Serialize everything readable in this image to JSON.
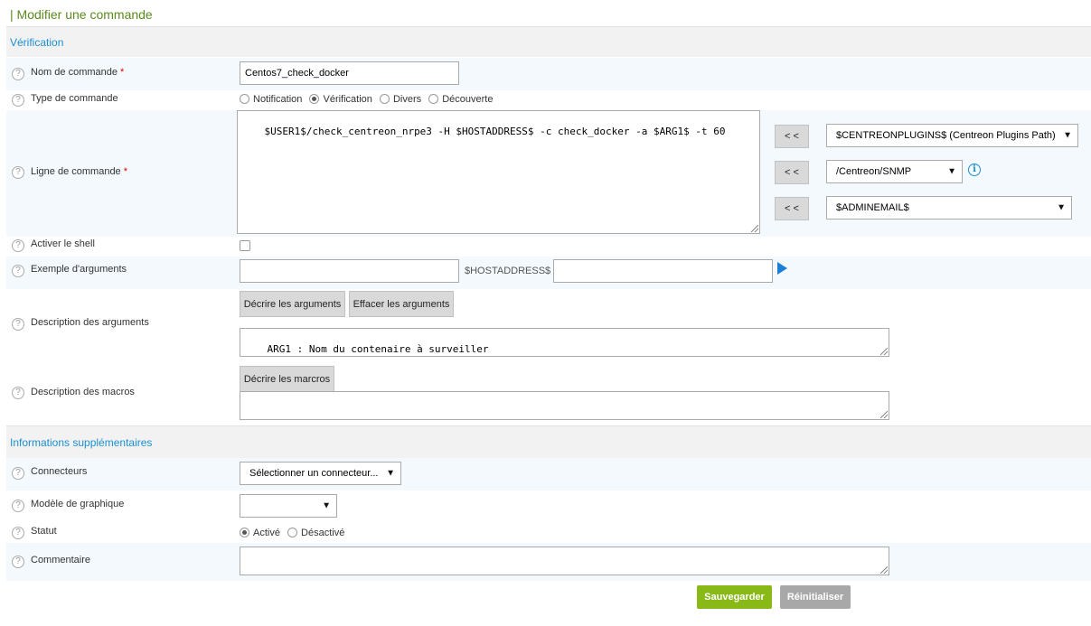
{
  "page_title": "| Modifier une commande",
  "sections": {
    "verification": "Vérification",
    "additional": "Informations supplémentaires"
  },
  "fields": {
    "command_name": {
      "label": "Nom de commande",
      "required": "*",
      "value": "Centos7_check_docker"
    },
    "command_type": {
      "label": "Type de commande",
      "options": [
        "Notification",
        "Vérification",
        "Divers",
        "Découverte"
      ],
      "selected": "Vérification"
    },
    "command_line": {
      "label": "Ligne de commande",
      "required": "*",
      "value": "$USER1$/check_centreon_nrpe3 -H $HOSTADDRESS$ -c check_docker -a $ARG1$ -t 60",
      "insert_button": "< <",
      "select_plugins": "$CENTREONPLUGINS$ (Centreon Plugins Path)",
      "select_path": "/Centreon/SNMP",
      "select_macro": "$ADMINEMAIL$"
    },
    "shell": {
      "label": "Activer le shell",
      "checked": false
    },
    "arg_example": {
      "label": "Exemple d'arguments",
      "value": "",
      "host_macro": "$HOSTADDRESS$",
      "value2": ""
    },
    "arg_description": {
      "label": "Description des arguments",
      "describe_button": "Décrire les arguments",
      "clear_button": "Effacer les arguments",
      "value": "ARG1 : Nom du contenaire à surveiller"
    },
    "macro_description": {
      "label": "Description des macros",
      "describe_button": "Décrire les marcros",
      "value": ""
    },
    "connectors": {
      "label": "Connecteurs",
      "value": "Sélectionner un connecteur..."
    },
    "graph_template": {
      "label": "Modèle de graphique",
      "value": ""
    },
    "status": {
      "label": "Statut",
      "options": [
        "Activé",
        "Désactivé"
      ],
      "selected": "Activé"
    },
    "comment": {
      "label": "Commentaire",
      "value": ""
    }
  },
  "actions": {
    "save": "Sauvegarder",
    "reset": "Réinitialiser"
  },
  "icons": {
    "help": "?",
    "info": "i",
    "dropdown": "▼"
  },
  "colors": {
    "title": "#5b8a1e",
    "section": "#1c8fd0",
    "save": "#88b917",
    "reset": "#a8a8a8"
  }
}
